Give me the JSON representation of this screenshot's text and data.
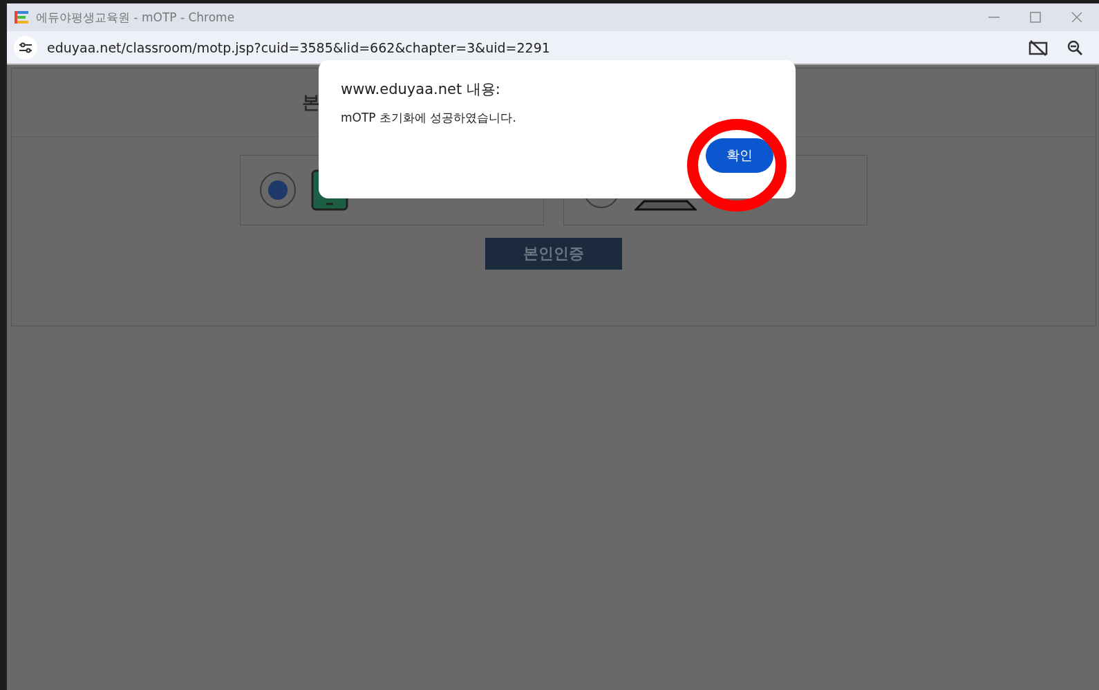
{
  "window": {
    "title": "에듀야평생교육원 - mOTP - Chrome"
  },
  "address_bar": {
    "url": "eduyaa.net/classroom/motp.jsp?cuid=3585&lid=662&chapter=3&uid=2291"
  },
  "page": {
    "heading": "본",
    "options": [
      {
        "kind": "phone",
        "selected": true
      },
      {
        "kind": "laptop",
        "selected": false
      }
    ],
    "submit": "본인인증"
  },
  "dialog": {
    "title": "www.eduyaa.net 내용:",
    "message": "mOTP 초기화에 성공하였습니다.",
    "ok": "확인",
    "highlighted": true
  }
}
